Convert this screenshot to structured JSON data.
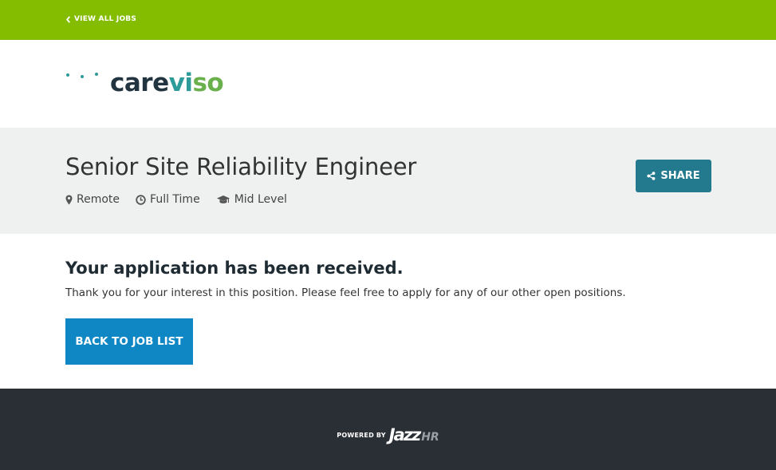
{
  "topbar": {
    "back_label": "VIEW ALL JOBS",
    "bg_color": "#84bd00"
  },
  "logo": {
    "part1": "care",
    "part2": "vi",
    "part3": "so"
  },
  "job": {
    "title": "Senior Site Reliability Engineer",
    "location": "Remote",
    "type": "Full Time",
    "level": "Mid Level",
    "share_label": "SHARE"
  },
  "confirmation": {
    "heading": "Your application has been received.",
    "message": "Thank you for your interest in this position. Please feel free to apply for any of our other open positions.",
    "back_button_label": "BACK TO JOB LIST"
  },
  "footer": {
    "powered_label": "POWERED BY",
    "brand_part1": "Jazz",
    "brand_part2": "HR"
  },
  "colors": {
    "share_button": "#237a8e",
    "back_button": "#0f87c5",
    "footer_bg": "#2a2f36",
    "header_bg": "#eff0f0"
  },
  "icons": {
    "back": "chevron-left-icon",
    "location": "map-marker-icon",
    "type": "clock-icon",
    "level": "graduation-cap-icon",
    "share": "share-icon"
  }
}
